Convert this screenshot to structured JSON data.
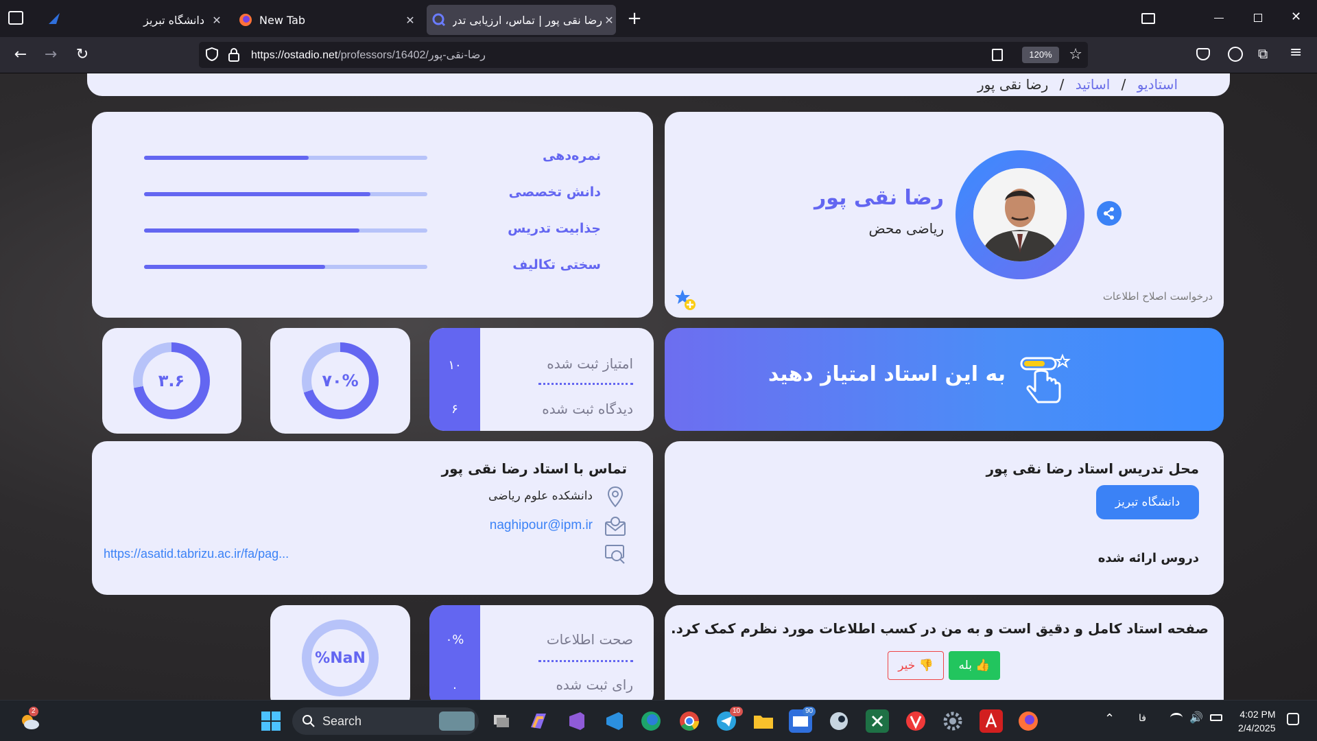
{
  "browser": {
    "tabs": [
      {
        "title": "دانشگاه تبریز",
        "active": false
      },
      {
        "title": "New Tab",
        "active": false
      },
      {
        "title": "رضا نقی پور | تماس، ارزیابی تدر",
        "active": true
      }
    ],
    "url_host": "https://ostadio.net",
    "url_path": "/professors/16402/رضا-نقی-پور",
    "zoom": "120%"
  },
  "breadcrumb": {
    "home": "استادیو",
    "sep1": "/",
    "professors": "اساتید",
    "sep2": "/",
    "current": "رضا نقی پور"
  },
  "profile": {
    "name": "رضا نقی پور",
    "field": "ریاضی محض",
    "edit_request": "درخواست اصلاح اطلاعات"
  },
  "ratings": [
    {
      "label": "نمره‌دهی",
      "value": 0.58
    },
    {
      "label": "دانش تخصصی",
      "value": 0.8
    },
    {
      "label": "جذابیت تدریس",
      "value": 0.76
    },
    {
      "label": "سختی تکالیف",
      "value": 0.64
    }
  ],
  "rate_cta": {
    "text": "به این استاد امتیاز دهید"
  },
  "stats1": {
    "rating_label": "امتیاز ثبت شده",
    "rating_count": "۱۰",
    "review_label": "دیدگاه ثبت شده",
    "review_count": "۶"
  },
  "donut1": {
    "text": "۷۰%",
    "value": 0.7
  },
  "donut2": {
    "text": "۳.۶",
    "value": 0.72
  },
  "teaching": {
    "title": "محل تدریس استاد رضا نقی پور",
    "university": "دانشگاه تبریز",
    "courses_title": "دروس ارائه شده"
  },
  "contact": {
    "title": "تماس با استاد رضا نقی پور",
    "faculty": "دانشکده علوم ریاضی",
    "email": "naghipour@ipm.ir",
    "website": "https://asatid.tabrizu.ac.ir/fa/pag..."
  },
  "feedback": {
    "question": "صفحه استاد کامل و دقیق است و به من در کسب اطلاعات مورد نظرم کمک کرد.",
    "yes": "بله",
    "no": "خیر"
  },
  "stats2": {
    "accuracy_label": "صحت اطلاعات",
    "accuracy_value": "۰%",
    "votes_label": "رای ثبت شده",
    "votes_value": "۰"
  },
  "donut3": {
    "text": "NaN%",
    "value": 0
  },
  "taskbar": {
    "search": "Search",
    "time": "4:02 PM",
    "date": "2/4/2025",
    "lang": "فا",
    "weather_badge": "2",
    "telegram_badge": "10",
    "mail_badge": "90"
  },
  "colors": {
    "accent": "#6366f1",
    "blue": "#3b82f6",
    "card_bg": "#ecedfd",
    "track": "#b7c3f9"
  }
}
